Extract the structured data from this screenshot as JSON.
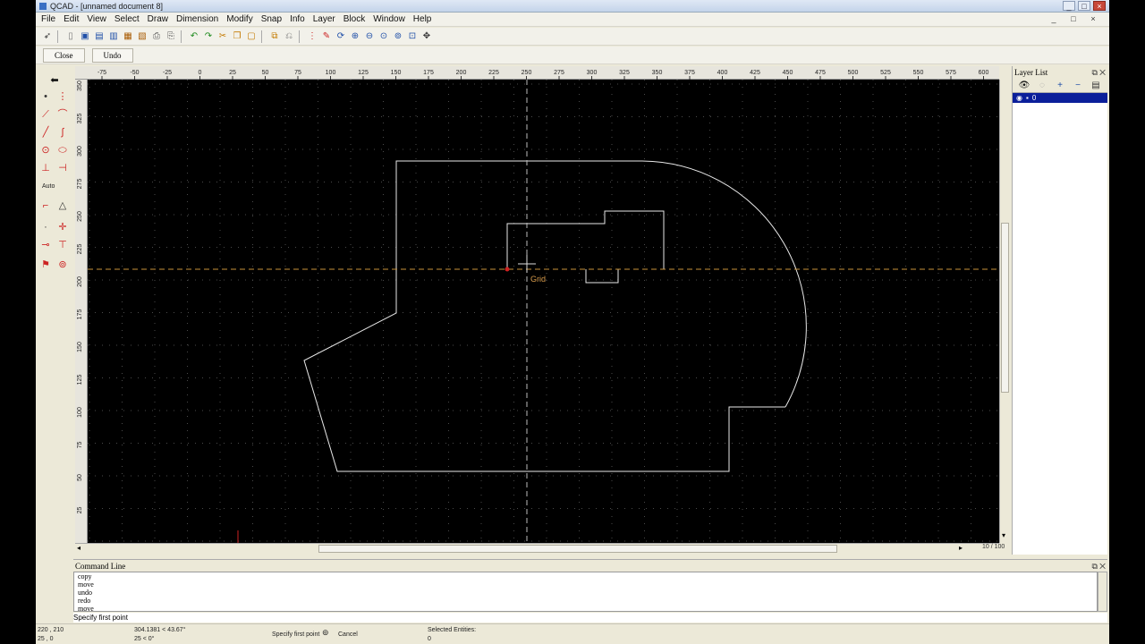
{
  "window": {
    "title": "QCAD - [unnamed document 8]",
    "controls": [
      "_",
      "□",
      "×"
    ],
    "mdi_controls": [
      "_",
      "□",
      "×"
    ]
  },
  "menu": [
    "File",
    "Edit",
    "View",
    "Select",
    "Draw",
    "Dimension",
    "Modify",
    "Snap",
    "Info",
    "Layer",
    "Block",
    "Window",
    "Help"
  ],
  "options_bar": {
    "close_label": "Close",
    "undo_label": "Undo"
  },
  "left_tools": {
    "auto_label": "Auto"
  },
  "rulers": {
    "top_ticks": [
      "-75",
      "-50",
      "-25",
      "0",
      "25",
      "50",
      "75",
      "100",
      "125",
      "150",
      "175",
      "200",
      "225",
      "250",
      "275",
      "300",
      "325",
      "350",
      "375",
      "400",
      "425",
      "450",
      "475",
      "500",
      "525",
      "550",
      "575",
      "600"
    ],
    "left_ticks": [
      "350",
      "325",
      "300",
      "275",
      "250",
      "225",
      "200",
      "175",
      "150",
      "125",
      "100",
      "75",
      "50",
      "25"
    ]
  },
  "canvas": {
    "snap_label": "Grid",
    "grid_info": "10 / 100"
  },
  "layer_panel": {
    "title": "Layer List",
    "layers": [
      {
        "name": "0",
        "visible": true,
        "locked": false
      }
    ]
  },
  "command_panel": {
    "title": "Command Line",
    "history": [
      "copy",
      "move",
      "undo",
      "redo",
      "move"
    ],
    "prompt": "Specify first point"
  },
  "status": {
    "abs_coords": "220 , 210",
    "abs_coords2": "25 , 0",
    "rel_coords": "304.1381 < 43.67°",
    "rel_coords2": "25 < 0°",
    "mouse_left": "Specify first point",
    "mouse_right": "Cancel",
    "selected_label": "Selected Entities:",
    "selected_count": "0"
  },
  "colors": {
    "canvas_bg": "#000000",
    "crosshair": "#c8923a",
    "geometry": "#e8e8e8",
    "grid": "#4a4a4a",
    "layer_selected": "#0b1f9a"
  }
}
